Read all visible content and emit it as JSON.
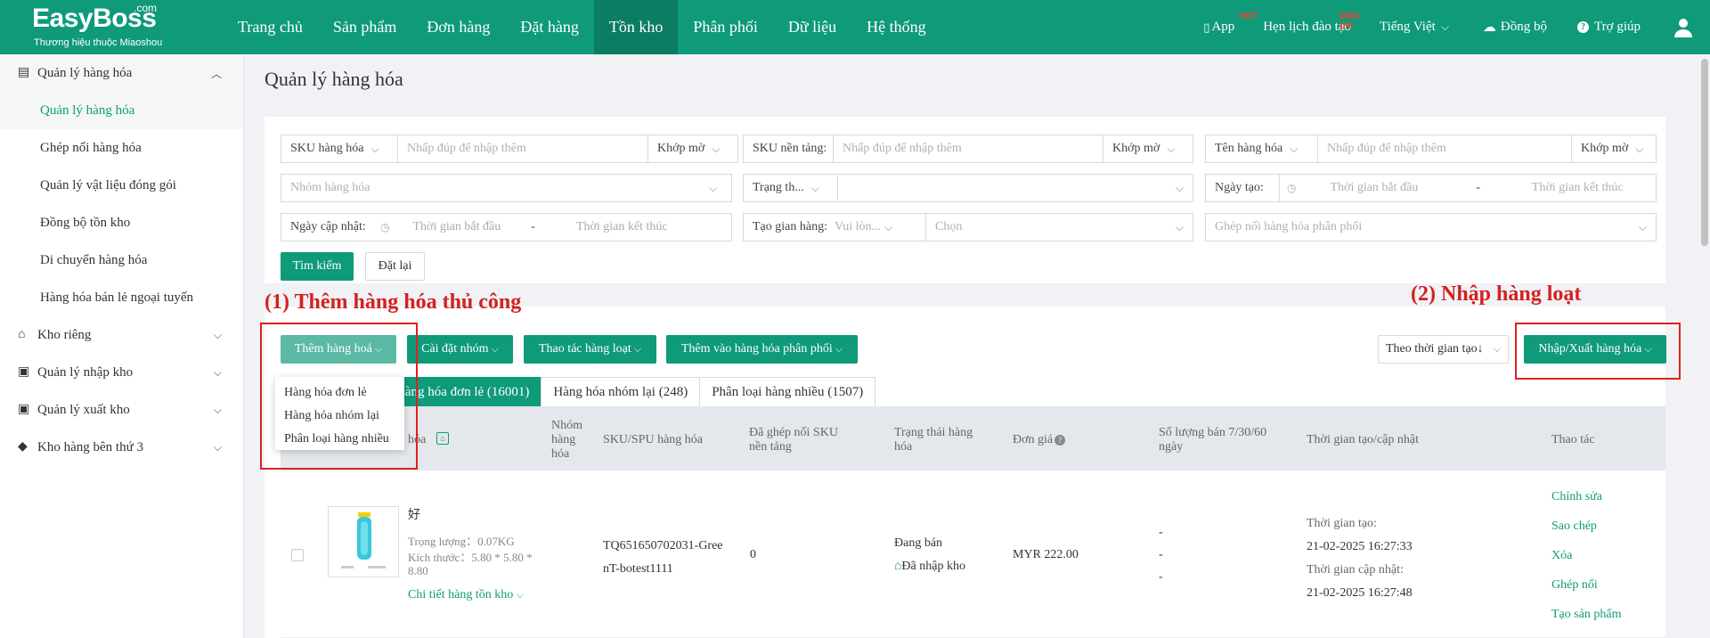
{
  "brand": {
    "name": "EasyBoss",
    "com": ".com",
    "subtitle": "Thương hiệu thuộc Miaoshou"
  },
  "nav": [
    "Trang chủ",
    "Sản phẩm",
    "Đơn hàng",
    "Đặt hàng",
    "Tồn kho",
    "Phân phối",
    "Dữ liệu",
    "Hệ thống"
  ],
  "nav_active": "Tồn kho",
  "tools": {
    "app": "App",
    "app_tag": "HOT",
    "training": "Hẹn lịch đào tạo",
    "training_tag": "Miễn phí",
    "lang": "Tiếng Việt",
    "sync": "Đồng bộ",
    "help": "Trợ giúp"
  },
  "sidebar": {
    "group1": "Quản lý hàng hóa",
    "items": [
      "Quản lý hàng hóa",
      "Ghép nối hàng hóa",
      "Quản lý vật liệu đóng gói",
      "Đồng bộ tồn kho",
      "Di chuyển hàng hóa",
      "Hàng hóa bán lẻ ngoại tuyến"
    ],
    "groups": [
      "Kho riêng",
      "Quản lý nhập kho",
      "Quản lý xuất kho",
      "Kho hàng bên thứ 3"
    ]
  },
  "page_title": "Quản lý hàng hóa",
  "filters": {
    "sku": "SKU hàng hóa",
    "sku_ph": "Nhấp đúp để nhập thêm",
    "match": "Khớp mờ",
    "sku_platform": "SKU nền tảng:",
    "name": "Tên hàng hóa",
    "group_ph": "Nhóm hàng hóa",
    "status": "Trạng th...",
    "created": "Ngày tạo:",
    "start": "Thời gian bắt đầu",
    "end": "Thời gian kết thúc",
    "dash": "-",
    "updated": "Ngày cập nhật:",
    "store": "Tạo gian hàng:",
    "store_ph": "Vui lòn...",
    "choose": "Chọn",
    "dist_ph": "Ghép nối hàng hóa phân phối",
    "search": "Tìm kiếm",
    "reset": "Đặt lại"
  },
  "annotations": {
    "a1": "(1) Thêm hàng hóa thủ công",
    "a2": "(2) Nhập hàng loạt"
  },
  "actions": {
    "add": "Thêm hàng hoá",
    "group_set": "Cài đặt nhóm",
    "batch": "Thao tác hàng loạt",
    "add_dist": "Thêm vào hàng hóa phân phối",
    "sort": "Theo thời gian tạo↓",
    "import": "Nhập/Xuất hàng hóa"
  },
  "dropdown": [
    "Hàng hóa đơn lẻ",
    "Hàng hóa nhóm lại",
    "Phân loại hàng nhiều"
  ],
  "tabs": [
    "Hàng hóa đơn lẻ (16001)",
    "Hàng hóa nhóm lại (248)",
    "Phân loại hàng nhiều (1507)"
  ],
  "columns": {
    "goods": "hóa",
    "group": "Nhóm\nhàng\nhóa",
    "sku": "SKU/SPU hàng hóa",
    "linked": "Đã ghép nối SKU nền tảng",
    "state": "Trạng thái hàng hóa",
    "price": "Đơn giá",
    "sold": "Số lượng bán 7/30/60 ngày",
    "time": "Thời gian tạo/cập nhật",
    "ops": "Thao tác"
  },
  "row": {
    "title": "好",
    "weight": "Trọng lượng：0.07KG",
    "size": "Kích thước：5.80 * 5.80 * 8.80",
    "detail": "Chi tiết hàng tồn kho",
    "sku": "TQ651650702031-GreenT-botest1111",
    "linked": "0",
    "state": "Đang bán",
    "warehouse": "Đã nhập kho",
    "price": "MYR 222.00",
    "sold": [
      "-",
      "-",
      "-"
    ],
    "created_label": "Thời gian tạo:",
    "created": "21-02-2025 16:27:33",
    "updated_label": "Thời gian cập nhật:",
    "updated": "21-02-2025 16:27:48",
    "ops": [
      "Chỉnh sửa",
      "Sao chép",
      "Xóa",
      "Ghép nối",
      "Tạo sản phẩm"
    ]
  }
}
